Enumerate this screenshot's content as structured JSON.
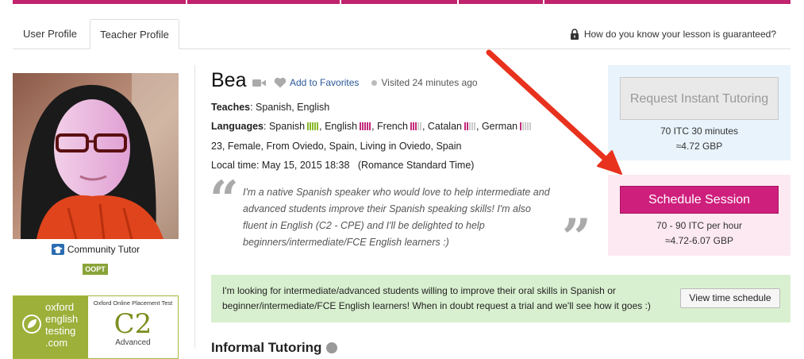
{
  "tabs": [
    {
      "label": "User Profile",
      "active": false
    },
    {
      "label": "Teacher Profile",
      "active": true
    }
  ],
  "guarantee_link": "How do you know your lesson is guaranteed?",
  "sidebar": {
    "community_tutor": "Community Tutor",
    "oopt_badge": "OOPT",
    "oxford": {
      "logo_line1": "oxford",
      "logo_line2": "english",
      "logo_line3": "testing",
      "logo_line4": ".com",
      "test_name": "Oxford Online Placement Test",
      "level": "C2",
      "level_label": "Advanced"
    }
  },
  "profile": {
    "name": "Bea",
    "favorites": "Add to Favorites",
    "visited": "Visited 24 minutes ago",
    "teaches_label": "Teaches",
    "teaches_value": ": Spanish, English",
    "languages_label": "Languages",
    "languages": [
      {
        "name": "Spanish",
        "level": 5,
        "color": "#8ab82d"
      },
      {
        "name": "English",
        "level": 5,
        "color": "#c42a7a"
      },
      {
        "name": "French",
        "level": 3,
        "color": "#c42a7a"
      },
      {
        "name": "Catalan",
        "level": 2,
        "color": "#c42a7a"
      },
      {
        "name": "German",
        "level": 1,
        "color": "#c42a7a"
      }
    ],
    "demographics": "23, Female, From Oviedo, Spain, Living in Oviedo, Spain",
    "local_time": "Local time: May 15, 2015 18:38",
    "timezone": "(Romance Standard Time)",
    "bio": "I'm a native Spanish speaker who would love to help intermediate and advanced students improve their Spanish speaking skills! I'm also fluent in English (C2 - CPE) and I'll be delighted to help beginners/intermediate/FCE English learners :)"
  },
  "instant": {
    "button": "Request Instant Tutoring",
    "price": "70 ITC 30 minutes",
    "converted": "≈4.72 GBP"
  },
  "schedule": {
    "button": "Schedule Session",
    "price": "70 - 90 ITC per hour",
    "converted": "≈4.72-6.07 GBP"
  },
  "notice": {
    "text": "I'm looking for intermediate/advanced students willing to improve their oral skills in Spanish or beginner/intermediate/FCE English learners! When in doubt request a trial and we'll see how it goes :)",
    "button": "View time schedule"
  },
  "section_heading": "Informal Tutoring",
  "colors": {
    "brand": "#c0246c",
    "schedule_button": "#cf1f7d",
    "annotation_arrow": "#e8321e"
  }
}
